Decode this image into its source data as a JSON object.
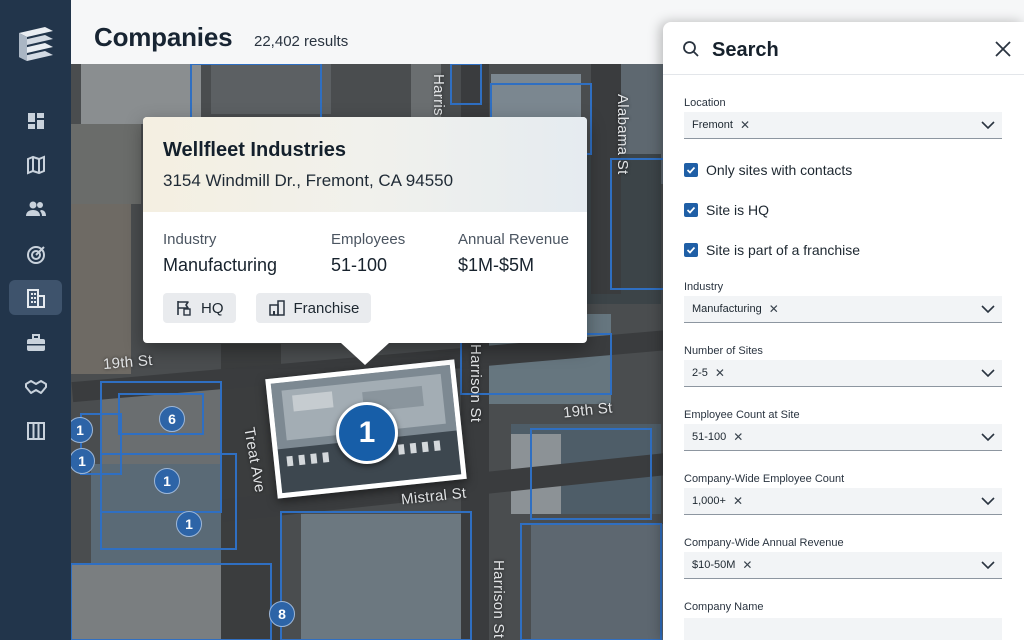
{
  "header": {
    "title": "Companies",
    "result_count": "22,402 results"
  },
  "nav": {
    "items": [
      {
        "name": "dashboard-icon",
        "active": false
      },
      {
        "name": "map-icon",
        "active": false
      },
      {
        "name": "people-icon",
        "active": false
      },
      {
        "name": "target-icon",
        "active": false
      },
      {
        "name": "companies-icon",
        "active": true
      },
      {
        "name": "briefcase-icon",
        "active": false
      },
      {
        "name": "handshake-icon",
        "active": false
      },
      {
        "name": "columns-icon",
        "active": false
      }
    ]
  },
  "map": {
    "streets": {
      "harrison_top": "Harris",
      "alabama": "Alabama St",
      "nineteenth_left": "19th St",
      "harrison_mid": "Harrison St",
      "nineteenth_right": "19th St",
      "treat": "Treat Ave",
      "mistral": "Mistral St",
      "harrison_bottom": "Harrison St"
    },
    "clusters": {
      "c6": "6",
      "c1a": "1",
      "c1b": "1",
      "c1c": "1",
      "c1d": "1",
      "c8": "8",
      "selected": "1"
    }
  },
  "popup": {
    "company_name": "Wellfleet Industries",
    "address": "3154 Windmill Dr., Fremont, CA 94550",
    "industry_label": "Industry",
    "industry_value": "Manufacturing",
    "employees_label": "Employees",
    "employees_value": "51-100",
    "revenue_label": "Annual Revenue",
    "revenue_value": "$1M-$5M",
    "tags": {
      "hq": "HQ",
      "franchise": "Franchise"
    }
  },
  "search_panel": {
    "title": "Search",
    "location": {
      "label": "Location",
      "chip": "Fremont"
    },
    "checkboxes": {
      "contacts": "Only sites with contacts",
      "hq": "Site is HQ",
      "franchise": "Site is part of a franchise"
    },
    "industry": {
      "label": "Industry",
      "chip": "Manufacturing"
    },
    "sites": {
      "label": "Number of Sites",
      "chip": "2-5"
    },
    "employee_site": {
      "label": "Employee Count at Site",
      "chip": "51-100"
    },
    "employee_company": {
      "label": "Company-Wide Employee Count",
      "chip": "1,000+"
    },
    "revenue": {
      "label": "Company-Wide Annual Revenue",
      "chip": "$10-50M"
    },
    "company_name": {
      "label": "Company Name"
    }
  },
  "colors": {
    "rail": "#22354b",
    "accent": "#1f5fa6",
    "pin": "#2d64a7"
  }
}
